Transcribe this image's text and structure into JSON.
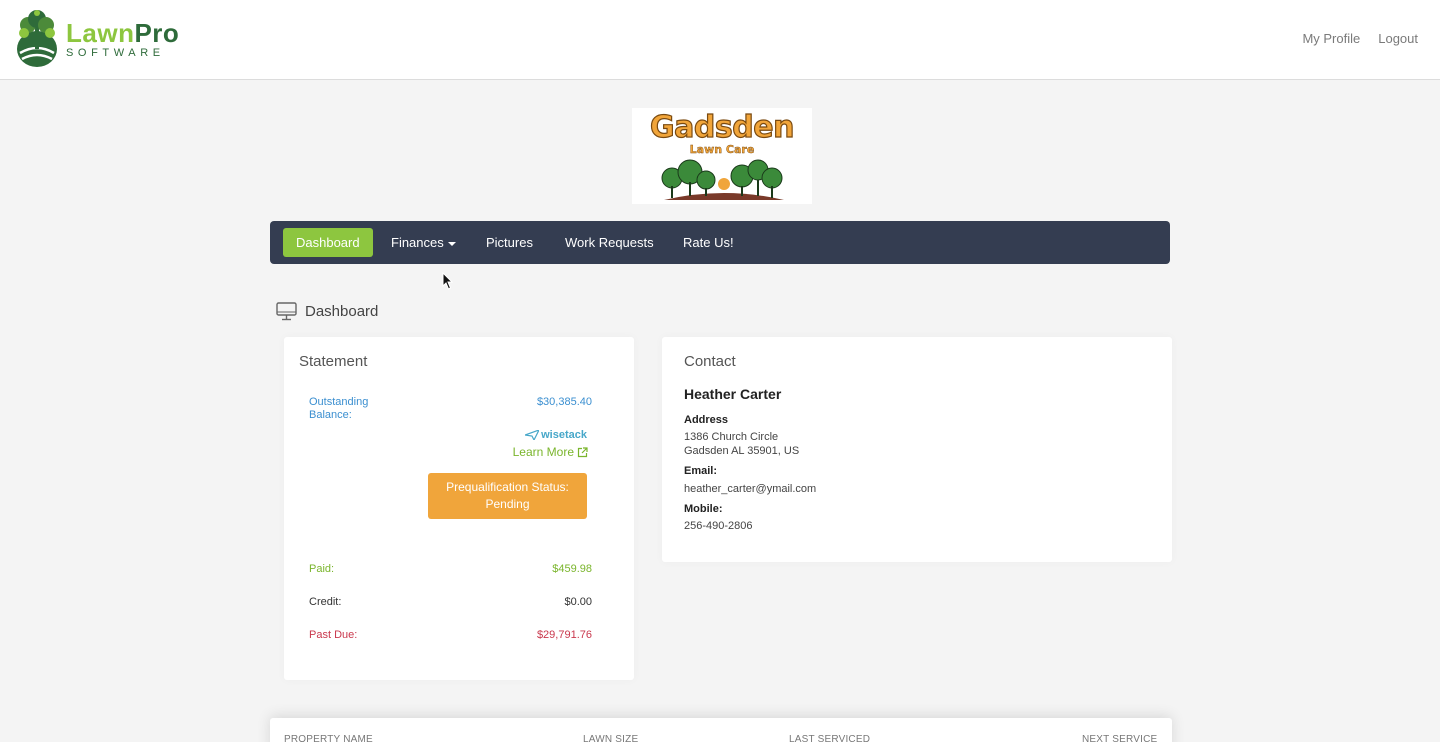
{
  "app": {
    "brand_name_part1": "Lawn",
    "brand_name_part2": "Pro",
    "brand_sub": "SOFTWARE",
    "accent_color": "#8dc63f"
  },
  "header": {
    "links": [
      "My Profile",
      "Logout"
    ]
  },
  "company_logo": {
    "title": "Gadsden",
    "subtitle": "Lawn Care"
  },
  "nav": {
    "items": [
      {
        "label": "Dashboard",
        "active": true
      },
      {
        "label": "Finances",
        "dropdown": true
      },
      {
        "label": "Pictures"
      },
      {
        "label": "Work Requests"
      },
      {
        "label": "Rate Us!"
      }
    ]
  },
  "page": {
    "title": "Dashboard",
    "icon": "monitor-icon"
  },
  "statement": {
    "title": "Statement",
    "outstanding_label_line1": "Outstanding",
    "outstanding_label_line2": "Balance:",
    "outstanding_value": "$30,385.40",
    "financing_brand": "wisetack",
    "learn_more": "Learn More",
    "prequal_line1": "Prequalification Status:",
    "prequal_line2": "Pending",
    "paid_label": "Paid:",
    "paid_value": "$459.98",
    "credit_label": "Credit:",
    "credit_value": "$0.00",
    "past_due_label": "Past Due:",
    "past_due_value": "$29,791.76"
  },
  "contact": {
    "title": "Contact",
    "name": "Heather Carter",
    "address_label": "Address",
    "address_line1": "1386 Church Circle",
    "address_line2": "Gadsden AL 35901, US",
    "email_label": "Email:",
    "email": "heather_carter@ymail.com",
    "mobile_label": "Mobile:",
    "mobile": "256-490-2806"
  },
  "properties_table": {
    "columns": [
      "PROPERTY NAME",
      "LAWN SIZE",
      "LAST SERVICED",
      "NEXT SERVICE"
    ]
  }
}
